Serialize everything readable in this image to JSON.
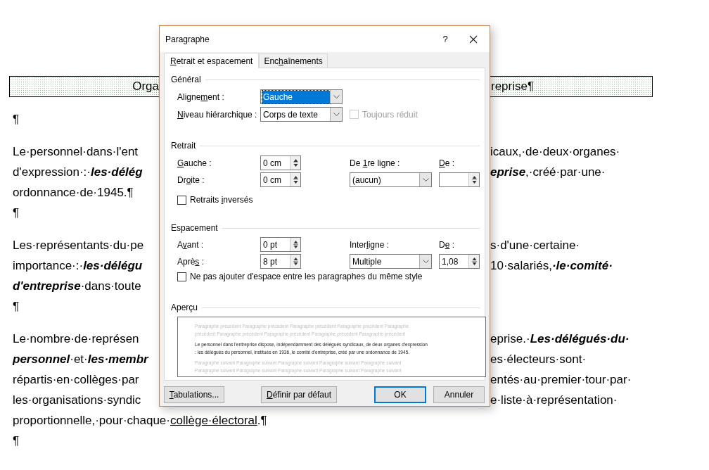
{
  "document": {
    "heading": {
      "left": "Orga",
      "right": "reprise¶"
    },
    "paragraphs": [
      {
        "kind": "blank",
        "lines": [
          {
            "left": [
              {
                "text": "¶",
                "kind": "plain"
              }
            ]
          }
        ]
      },
      {
        "kind": "text",
        "lines": [
          {
            "left": [
              {
                "text": "Le·personnel·dans·l'ent",
                "kind": "plain"
              }
            ],
            "right": [
              {
                "text": "icaux,·de·deux·organes·",
                "kind": "plain"
              }
            ]
          },
          {
            "left": [
              {
                "text": "d'expression·:·",
                "kind": "plain"
              },
              {
                "text": "les·délég",
                "kind": "emphasis"
              }
            ],
            "right": [
              {
                "text": "eprise",
                "kind": "emphasis"
              },
              {
                "text": ",·créé·par·une·",
                "kind": "plain"
              }
            ]
          },
          {
            "left": [
              {
                "text": "ordonnance·de·1945.¶",
                "kind": "plain"
              }
            ]
          }
        ]
      },
      {
        "kind": "blank",
        "lines": [
          {
            "left": [
              {
                "text": "¶",
                "kind": "plain"
              }
            ]
          }
        ]
      },
      {
        "kind": "text",
        "lines": [
          {
            "left": [
              {
                "text": "Les·représentants·du·pe",
                "kind": "plain"
              }
            ],
            "right": [
              {
                "text": "s·d'une·certaine·",
                "kind": "plain"
              }
            ]
          },
          {
            "left": [
              {
                "text": "importance·:·",
                "kind": "plain"
              },
              {
                "text": "les·délégu",
                "kind": "emphasis"
              }
            ],
            "right": [
              {
                "text": "10·salariés,",
                "kind": "plain"
              },
              {
                "text": "·le·comité·",
                "kind": "emphasis"
              }
            ]
          },
          {
            "left": [
              {
                "text": "d'entreprise",
                "kind": "emphasis"
              },
              {
                "text": "·dans·toute",
                "kind": "plain"
              }
            ]
          }
        ]
      },
      {
        "kind": "blank",
        "lines": [
          {
            "left": [
              {
                "text": "¶",
                "kind": "plain"
              }
            ]
          }
        ]
      },
      {
        "kind": "text",
        "lines": [
          {
            "left": [
              {
                "text": "Le·nombre·de·représen",
                "kind": "plain"
              }
            ],
            "right": [
              {
                "text": "eprise.·",
                "kind": "plain"
              },
              {
                "text": "Les·délégués·du·",
                "kind": "emphasis"
              }
            ]
          },
          {
            "left": [
              {
                "text": "personnel",
                "kind": "emphasis"
              },
              {
                "text": "·et·",
                "kind": "plain"
              },
              {
                "text": "les·membr",
                "kind": "emphasis"
              }
            ],
            "right": [
              {
                "text": "es·électeurs·sont·",
                "kind": "plain"
              }
            ]
          },
          {
            "left": [
              {
                "text": "répartis·en·collèges·par",
                "kind": "plain"
              }
            ],
            "right": [
              {
                "text": "entés·au·premier·tour·par·",
                "kind": "plain"
              }
            ]
          },
          {
            "left": [
              {
                "text": "les·organisations·syndic",
                "kind": "plain"
              }
            ],
            "right": [
              {
                "text": "e·liste·à·représentation·",
                "kind": "plain"
              }
            ]
          },
          {
            "left": [
              {
                "text": "proportionnelle,·pour·chaque·",
                "kind": "plain"
              },
              {
                "text": "collège·électoral",
                "kind": "underline"
              },
              {
                "text": ".¶",
                "kind": "plain"
              }
            ]
          }
        ]
      },
      {
        "kind": "blank",
        "lines": [
          {
            "left": [
              {
                "text": "¶",
                "kind": "plain"
              }
            ]
          }
        ]
      }
    ]
  },
  "dialog": {
    "title": "Paragraphe",
    "help": "?",
    "tabs": [
      {
        "label": {
          "key": "R",
          "post": "etrait et espacement"
        },
        "selected": true
      },
      {
        "label": {
          "pre": "Enc",
          "key": "h",
          "post": "aînements"
        },
        "selected": false
      }
    ],
    "general": {
      "title": "Général",
      "alignment": {
        "label": {
          "pre": "Aligne",
          "key": "m",
          "post": "ent :"
        },
        "value": "Gauche",
        "focused": true
      },
      "outline_level": {
        "label": {
          "key": "N",
          "post": "iveau hiérarchique :"
        },
        "value": "Corps de texte",
        "focused": false
      },
      "collapsed": {
        "label": "Toujours réduit",
        "checked": false,
        "disabled": true
      }
    },
    "indentation": {
      "title": "Retrait",
      "left": {
        "label": {
          "key": "G",
          "post": "auche :"
        },
        "value": "0 cm"
      },
      "right": {
        "label": {
          "pre": "Dr",
          "key": "o",
          "post": "ite :"
        },
        "value": "0 cm"
      },
      "special": {
        "label": {
          "pre": "De ",
          "key": "1",
          "post": "re ligne :"
        },
        "value": "(aucun)",
        "focused": false
      },
      "by": {
        "label": {
          "key": "D",
          "post": "e :"
        }
      },
      "mirror": {
        "label": {
          "pre": "Retraits ",
          "key": "i",
          "post": "nversés"
        },
        "checked": false,
        "disabled": false
      }
    },
    "spacing": {
      "title": "Espacement",
      "before": {
        "label": {
          "pre": "A",
          "key": "v",
          "post": "ant :"
        },
        "value": "0 pt"
      },
      "after": {
        "label": {
          "pre": "Aprè",
          "key": "s",
          "post": " :"
        },
        "value": "8 pt"
      },
      "line_spacing": {
        "label": {
          "pre": "Inter",
          "key": "l",
          "post": "igne :"
        },
        "value": "Multiple",
        "focused": false
      },
      "at": {
        "label": {
          "pre": "D",
          "key": "e",
          "post": " :"
        },
        "value": "1,08"
      },
      "no_space": {
        "label": {
          "pre": "Ne pas a",
          "key": "j",
          "post": "outer d'espace entre les paragraphes du même style"
        },
        "checked": false,
        "disabled": false
      }
    },
    "preview": {
      "title": "Aperçu",
      "lines": [
        {
          "kind": "previous",
          "text": "Paragraphe précédent Paragraphe précédent Paragraphe précédent Paragraphe précédent Paragraphe"
        },
        {
          "kind": "previous",
          "text": "précédent Paragraphe précédent Paragraphe précédent Paragraphe précédent Paragraphe précédent"
        },
        {
          "kind": "current",
          "text": "Le personnel dans l'entreprise dispose, indépendamment des délégués syndicaux, de deux organes d'expression"
        },
        {
          "kind": "current",
          "text": ": les délégués du personnel, institués en 1936, le comité d'entreprise, créé par une ordonnance de 1945."
        },
        {
          "kind": "next",
          "text": "Paragraphe suivant Paragraphe suivant Paragraphe suivant Paragraphe suivant Paragraphe suivant"
        },
        {
          "kind": "next",
          "text": "Paragraphe suivant Paragraphe suivant Paragraphe suivant Paragraphe suivant Paragraphe suivant"
        }
      ]
    },
    "buttons": [
      {
        "label": {
          "key": "T",
          "post": "abulations..."
        },
        "default": false
      },
      {
        "label": {
          "key": "D",
          "post": "éfinir par défaut"
        },
        "default": false
      },
      {
        "label": {
          "pre": "OK"
        },
        "default": true
      },
      {
        "label": {
          "pre": "Annuler"
        },
        "default": false
      }
    ]
  }
}
